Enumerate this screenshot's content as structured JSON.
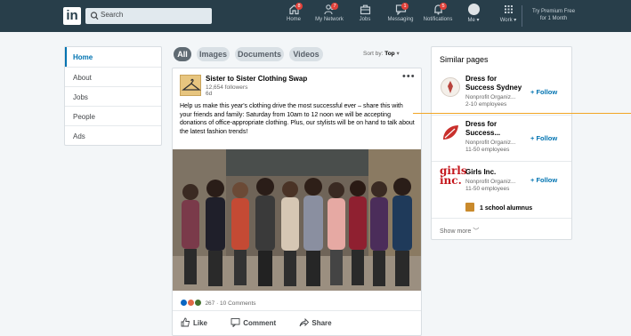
{
  "topbar": {
    "logo": "in",
    "search_placeholder": "Search",
    "nav": [
      {
        "label": "Home",
        "icon": "home-icon",
        "badge": "8"
      },
      {
        "label": "My Network",
        "icon": "network-icon",
        "badge": "7"
      },
      {
        "label": "Jobs",
        "icon": "jobs-icon",
        "badge": ""
      },
      {
        "label": "Messaging",
        "icon": "messaging-icon",
        "badge": "1"
      },
      {
        "label": "Notifications",
        "icon": "bell-icon",
        "badge": "5"
      },
      {
        "label": "Me ▾",
        "icon": "avatar",
        "badge": ""
      },
      {
        "label": "Work ▾",
        "icon": "grid-icon",
        "badge": ""
      }
    ],
    "premium_line1": "Try Premium Free",
    "premium_line2": "for 1 Month"
  },
  "sidenav": {
    "items": [
      "Home",
      "About",
      "Jobs",
      "People",
      "Ads"
    ],
    "active": "Home"
  },
  "filters": {
    "chips": [
      "All",
      "Images",
      "Documents",
      "Videos"
    ],
    "active": "All",
    "sort_prefix": "Sort by:",
    "sort_value": "Top"
  },
  "post": {
    "author": "Sister to Sister Clothing Swap",
    "followers": "12,654 followers",
    "time": "6d",
    "menu": "•••",
    "text": "Help us make this year's clothing drive the most successful ever – share this with your friends and family: Saturday from 10am to 12 noon we will be accepting donations of office-appropriate clothing. Plus, our stylists will be on hand to talk about the latest fashion trends!",
    "reactions": "267 · 10 Comments",
    "actions": {
      "like": "Like",
      "comment": "Comment",
      "share": "Share"
    }
  },
  "similar": {
    "title": "Similar pages",
    "pages": [
      {
        "name_line1": "Dress for",
        "name_line2": "Success Sydney",
        "meta1": "Nonprofit Organiz...",
        "meta2": "2-10 employees",
        "follow": "+ Follow"
      },
      {
        "name_line1": "Dress for",
        "name_line2": "Success...",
        "meta1": "Nonprofit Organiz...",
        "meta2": "11-50 employees",
        "follow": "+ Follow"
      },
      {
        "name_line1": "Girls Inc.",
        "name_line2": "",
        "meta1": "Nonprofit Organiz...",
        "meta2": "11-50 employees",
        "follow": "+ Follow",
        "logo_text1": "girls",
        "logo_text2": "inc."
      }
    ],
    "alumni": "1 school alumnus",
    "show_more": "Show more"
  },
  "colors": {
    "topbar": "#283e4a",
    "accent": "#0073b1",
    "badge": "#e0413a",
    "highlight_line": "#f2a524"
  }
}
